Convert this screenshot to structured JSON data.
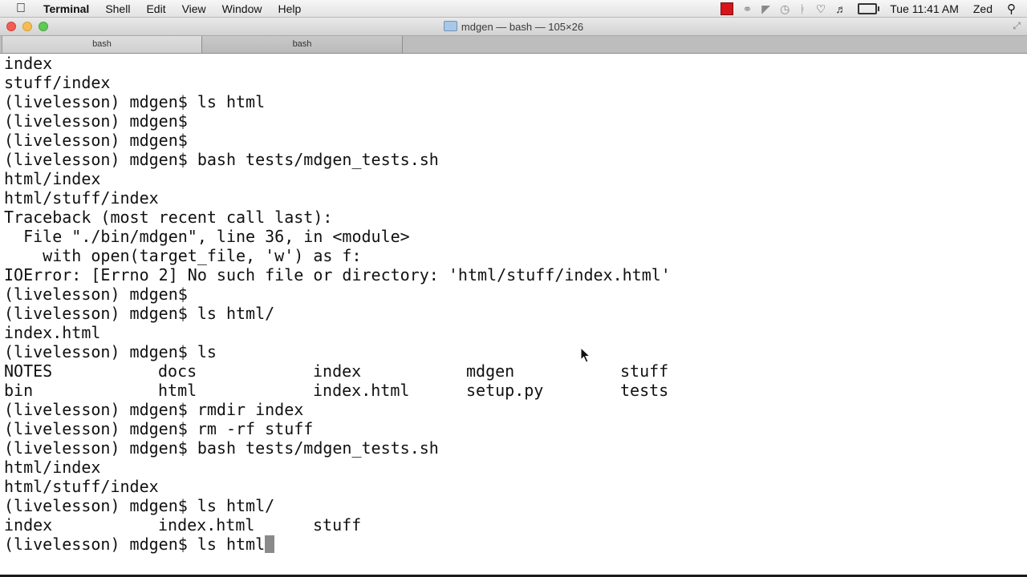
{
  "menubar": {
    "app_name": "Terminal",
    "menus": [
      "Shell",
      "Edit",
      "View",
      "Window",
      "Help"
    ],
    "clock": "Tue 11:41 AM",
    "user": "Zed"
  },
  "window": {
    "title": "mdgen — bash — 105×26"
  },
  "tabs": [
    {
      "label": "bash"
    },
    {
      "label": "bash"
    }
  ],
  "terminal": {
    "lines_before": [
      "index",
      "stuff/index",
      "(livelesson) mdgen$ ls html",
      "(livelesson) mdgen$",
      "(livelesson) mdgen$",
      "(livelesson) mdgen$ bash tests/mdgen_tests.sh",
      "html/index",
      "html/stuff/index",
      "Traceback (most recent call last):",
      "  File \"./bin/mdgen\", line 36, in <module>",
      "    with open(target_file, 'w') as f:",
      "IOError: [Errno 2] No such file or directory: 'html/stuff/index.html'",
      "(livelesson) mdgen$",
      "(livelesson) mdgen$ ls html/",
      "index.html",
      "(livelesson) mdgen$ ls"
    ],
    "ls_rows": [
      [
        "NOTES",
        "docs",
        "index",
        "mdgen",
        "stuff"
      ],
      [
        "bin",
        "html",
        "index.html",
        "setup.py",
        "tests"
      ]
    ],
    "lines_after": [
      "(livelesson) mdgen$ rmdir index",
      "(livelesson) mdgen$ rm -rf stuff",
      "(livelesson) mdgen$ bash tests/mdgen_tests.sh",
      "html/index",
      "html/stuff/index",
      "(livelesson) mdgen$ ls html/"
    ],
    "ls_rows_2": [
      [
        "index",
        "index.html",
        "stuff"
      ]
    ],
    "current_prompt": "(livelesson) mdgen$ ls html"
  },
  "colors": {
    "record_indicator": "#d8141b",
    "close_button": "#f25e56",
    "minimize_button": "#f6be4f",
    "zoom_button": "#5fcb57"
  }
}
